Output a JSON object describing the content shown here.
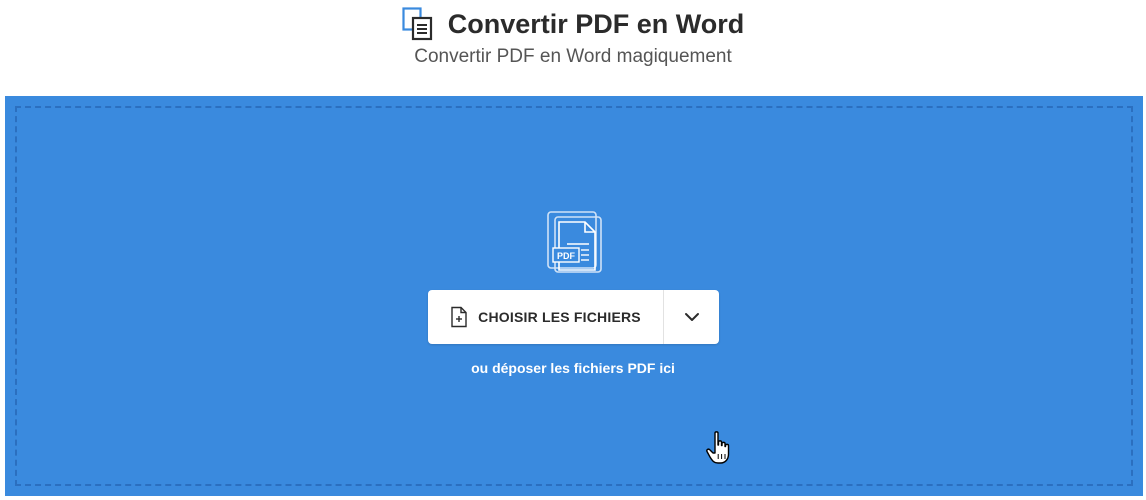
{
  "header": {
    "title": "Convertir PDF en Word",
    "subtitle": "Convertir PDF en Word magiquement",
    "icon": "pdf-to-word-icon"
  },
  "dropzone": {
    "background_color": "#3a8ade",
    "file_icon": "pdf-files-icon",
    "choose_button_label": "CHOISIR LES FICHIERS",
    "choose_button_icon": "file-plus-icon",
    "dropdown_icon": "chevron-down-icon",
    "drop_hint": "ou déposer les fichiers PDF ici",
    "pdf_badge": "PDF"
  },
  "cursor": {
    "icon": "hand-pointer-icon"
  }
}
